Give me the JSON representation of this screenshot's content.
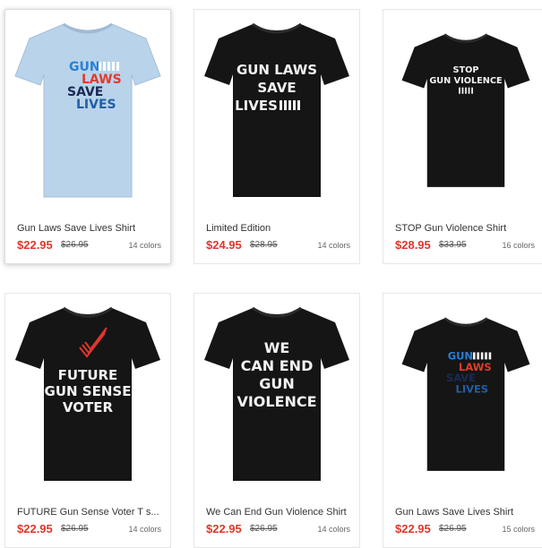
{
  "products": [
    {
      "title": "Gun Laws Save Lives Shirt",
      "price": "$22.95",
      "old_price": "$26.95",
      "colors": "14 colors",
      "shirt_color": "#b9d3ea",
      "print": [
        "GUN",
        "LAWS",
        "SAVE",
        "LIVES"
      ]
    },
    {
      "title": "Limited Edition",
      "price": "$24.95",
      "old_price": "$28.95",
      "colors": "14 colors",
      "shirt_color": "#151515",
      "print": [
        "GUN LAWS",
        "SAVE",
        "LIVES"
      ]
    },
    {
      "title": "STOP Gun Violence Shirt",
      "price": "$28.95",
      "old_price": "$33.95",
      "colors": "16 colors",
      "shirt_color": "#151515",
      "print": [
        "STOP",
        "GUN VIOLENCE"
      ]
    },
    {
      "title": "FUTURE Gun Sense Voter T s...",
      "price": "$22.95",
      "old_price": "$26.95",
      "colors": "14 colors",
      "shirt_color": "#151515",
      "print": [
        "FUTURE",
        "GUN SENSE",
        "VOTER"
      ]
    },
    {
      "title": "We Can End Gun Violence Shirt",
      "price": "$22.95",
      "old_price": "$26.95",
      "colors": "14 colors",
      "shirt_color": "#151515",
      "print": [
        "WE",
        "CAN END",
        "GUN",
        "VIOLENCE"
      ]
    },
    {
      "title": "Gun Laws Save Lives Shirt",
      "price": "$22.95",
      "old_price": "$26.95",
      "colors": "15 colors",
      "shirt_color": "#151515",
      "print": [
        "GUN",
        "LAWS",
        "SAVE",
        "LIVES"
      ]
    }
  ]
}
